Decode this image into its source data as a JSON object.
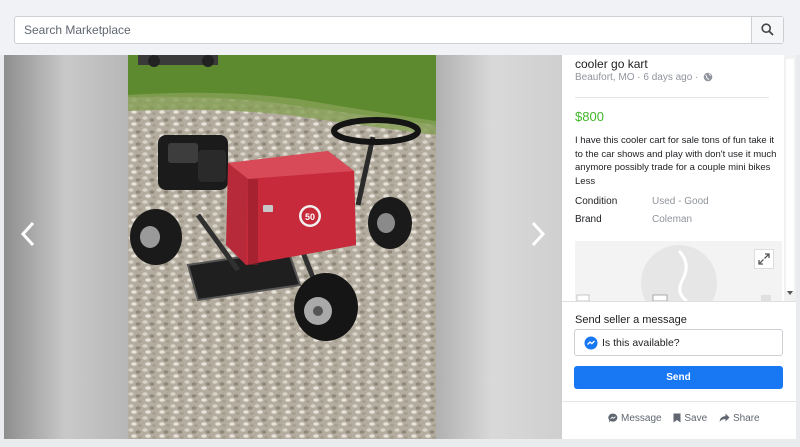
{
  "search": {
    "placeholder": "Search Marketplace",
    "icon": "search-icon"
  },
  "listing": {
    "title": "cooler go kart",
    "location": "Beaufort, MO",
    "sep": "·",
    "posted": "6 days ago",
    "sep2": "·",
    "price": "$800",
    "description": "I have this cooler cart for sale tons of fun take it to the car shows and play with don't use it much anymore possibly trade for a couple mini bikes",
    "less_label": "Less",
    "details": [
      {
        "label": "Condition",
        "value": "Used - Good"
      },
      {
        "label": "Brand",
        "value": "Coleman"
      }
    ],
    "cooler_number": "50"
  },
  "message": {
    "heading": "Send seller a message",
    "text": "Is this available?",
    "send_label": "Send"
  },
  "actions": [
    {
      "label": "Message",
      "icon": "messenger-bubble-icon"
    },
    {
      "label": "Save",
      "icon": "bookmark-icon"
    },
    {
      "label": "Share",
      "icon": "share-arrow-icon"
    }
  ],
  "colors": {
    "price": "#42b72a",
    "primary": "#1877f2",
    "cooler": "#c62a3b"
  }
}
